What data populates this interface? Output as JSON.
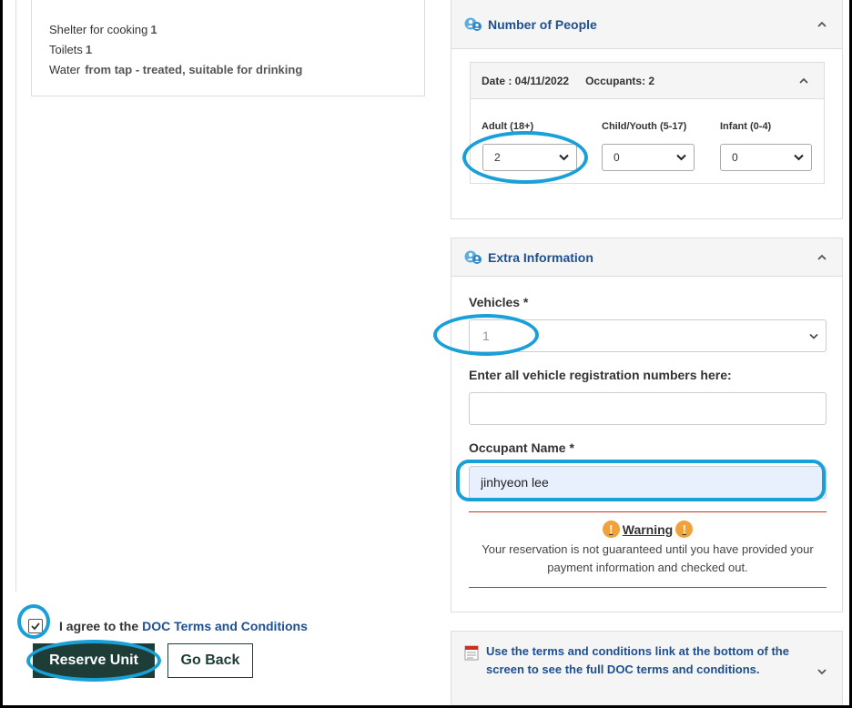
{
  "amenities": {
    "items": [
      {
        "label": "Shelter for cooking",
        "value": "1"
      },
      {
        "label": "Toilets",
        "value": "1"
      },
      {
        "label": "Water",
        "value": "from tap - treated, suitable for drinking"
      }
    ]
  },
  "people_panel": {
    "title": "Number of People",
    "date_label": "Date : 04/11/2022",
    "occupants_label": "Occupants: 2",
    "adult_label": "Adult (18+)",
    "adult_value": "2",
    "child_label": "Child/Youth (5-17)",
    "child_value": "0",
    "infant_label": "Infant (0-4)",
    "infant_value": "0"
  },
  "extra_panel": {
    "title": "Extra Information",
    "vehicles_label": "Vehicles *",
    "vehicles_value": "1",
    "registration_label": "Enter all vehicle registration numbers here:",
    "registration_value": "",
    "occupant_label": "Occupant Name *",
    "occupant_value": "jinhyeon lee",
    "warning_title": "Warning",
    "warning_text": "Your reservation is not guaranteed until you have provided your payment information and checked out."
  },
  "terms_panel": {
    "text": "Use the terms and conditions link at the bottom of the screen to see the full DOC terms and conditions."
  },
  "agreement": {
    "prefix": "I agree to the",
    "link": "DOC Terms and Conditions",
    "checked": true
  },
  "buttons": {
    "reserve": "Reserve Unit",
    "back": "Go Back"
  },
  "colors": {
    "accent": "#1d4f91",
    "button_dark": "#1e3d36",
    "warning": "#f0a13a",
    "highlight_ring": "#1aa0d8"
  }
}
